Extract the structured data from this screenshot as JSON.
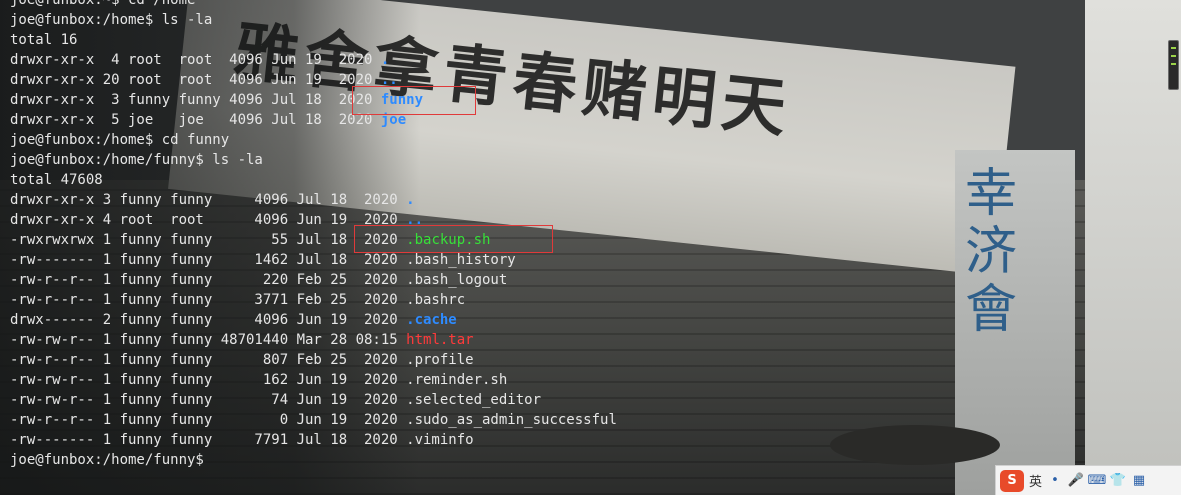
{
  "terminal": {
    "lines": [
      {
        "text": "joe@funbox:~$ cd /home"
      },
      {
        "text": "joe@funbox:/home$ ls -la"
      },
      {
        "text": "total 16"
      },
      {
        "text": "drwxr-xr-x  4 root  root  4096 Jun 19  2020 ",
        "tail": ".",
        "tail_color": "blue"
      },
      {
        "text": "drwxr-xr-x 20 root  root  4096 Jun 19  2020 ",
        "tail": "..",
        "tail_color": "blue"
      },
      {
        "text": "drwxr-xr-x  3 funny funny 4096 Jul 18  2020 ",
        "tail": "funny",
        "tail_color": "blue"
      },
      {
        "text": "drwxr-xr-x  5 joe   joe   4096 Jul 18  2020 ",
        "tail": "joe",
        "tail_color": "blue"
      },
      {
        "text": "joe@funbox:/home$ cd funny"
      },
      {
        "text": "joe@funbox:/home/funny$ ls -la"
      },
      {
        "text": "total 47608"
      },
      {
        "text": "drwxr-xr-x 3 funny funny     4096 Jul 18  2020 ",
        "tail": ".",
        "tail_color": "blue"
      },
      {
        "text": "drwxr-xr-x 4 root  root      4096 Jun 19  2020 ",
        "tail": "..",
        "tail_color": "blue"
      },
      {
        "text": "-rwxrwxrwx 1 funny funny       55 Jul 18  2020 ",
        "tail": ".backup.sh",
        "tail_color": "green"
      },
      {
        "text": "-rw------- 1 funny funny     1462 Jul 18  2020 .bash_history"
      },
      {
        "text": "-rw-r--r-- 1 funny funny      220 Feb 25  2020 .bash_logout"
      },
      {
        "text": "-rw-r--r-- 1 funny funny     3771 Feb 25  2020 .bashrc"
      },
      {
        "text": "drwx------ 2 funny funny     4096 Jun 19  2020 ",
        "tail": ".cache",
        "tail_color": "blue"
      },
      {
        "text": "-rw-rw-r-- 1 funny funny 48701440 Mar 28 08:15 ",
        "tail": "html.tar",
        "tail_color": "red"
      },
      {
        "text": "-rw-r--r-- 1 funny funny      807 Feb 25  2020 .profile"
      },
      {
        "text": "-rw-rw-r-- 1 funny funny      162 Jun 19  2020 .reminder.sh"
      },
      {
        "text": "-rw-rw-r-- 1 funny funny       74 Jun 19  2020 .selected_editor"
      },
      {
        "text": "-rw-r--r-- 1 funny funny        0 Jun 19  2020 .sudo_as_admin_successful"
      },
      {
        "text": "-rw------- 1 funny funny     7791 Jul 18  2020 .viminfo"
      },
      {
        "text": "joe@funbox:/home/funny$ "
      }
    ]
  },
  "wallpaper": {
    "slogan": "雅舍拿青春赌明天",
    "vertical": "幸济會"
  },
  "ime": {
    "logo": "S",
    "lang": "英",
    "icons": [
      "dot-icon",
      "mic-icon",
      "keyboard-icon",
      "shirt-icon",
      "grid-icon"
    ]
  },
  "colors": {
    "dir": "#2e8bff",
    "exec": "#37e039",
    "archive": "#ff3a3a",
    "highlight_box": "#e03a3a"
  }
}
